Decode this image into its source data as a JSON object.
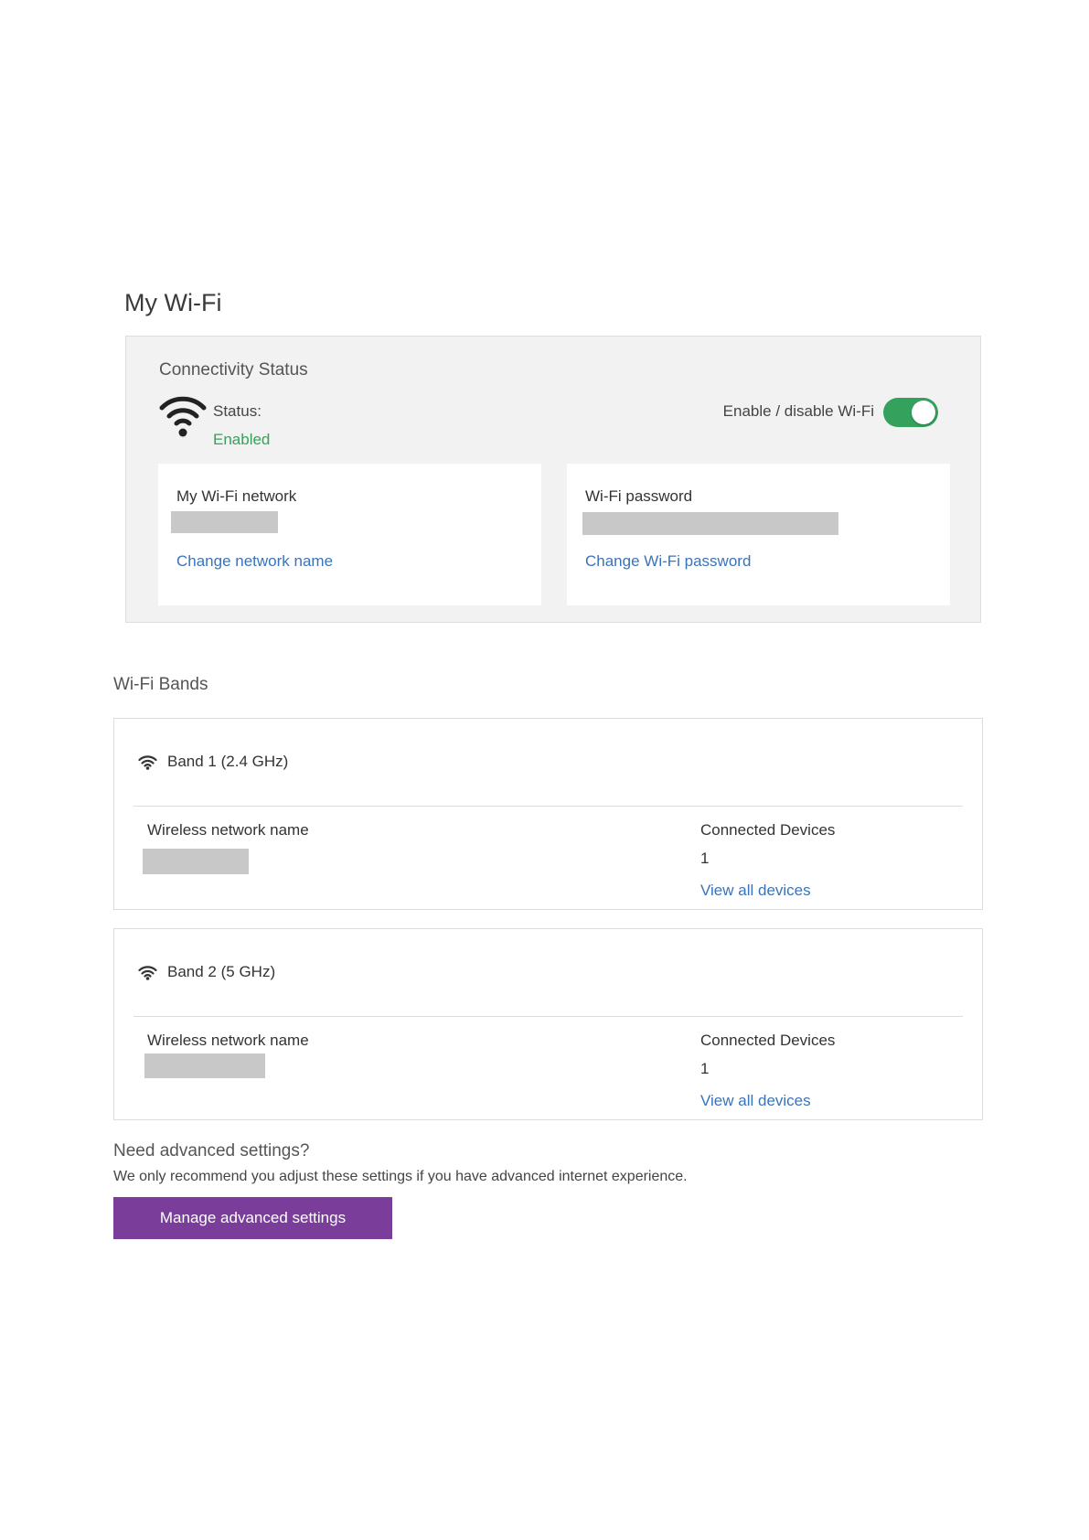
{
  "page": {
    "title": "My Wi-Fi"
  },
  "connectivity": {
    "section_label": "Connectivity Status",
    "status_label": "Status:",
    "status_value": "Enabled",
    "status_color": "#2fa55a",
    "toggle_label": "Enable / disable Wi-Fi",
    "toggle_on": true,
    "toggle_color": "#34a15c",
    "network_card": {
      "title": "My Wi-Fi network",
      "value": "",
      "link": "Change network name"
    },
    "password_card": {
      "title": "Wi-Fi password",
      "value": "",
      "link": "Change Wi-Fi password"
    }
  },
  "bands": {
    "section_label": "Wi-Fi Bands",
    "items": [
      {
        "title": "Band 1 (2.4 GHz)",
        "name_label": "Wireless network name",
        "name_value": "",
        "devices_label": "Connected Devices",
        "devices_count": "1",
        "devices_link": "View all devices"
      },
      {
        "title": "Band 2 (5 GHz)",
        "name_label": "Wireless network name",
        "name_value": "",
        "devices_label": "Connected Devices",
        "devices_count": "1",
        "devices_link": "View all devices"
      }
    ]
  },
  "advanced": {
    "title": "Need advanced settings?",
    "description": "We only recommend you adjust these settings if you have advanced internet experience.",
    "button_label": "Manage advanced settings",
    "button_color": "#7a3d99"
  },
  "colors": {
    "link": "#3b73b9",
    "redaction": "#c8c8c8"
  },
  "icons": [
    "wifi-icon"
  ]
}
